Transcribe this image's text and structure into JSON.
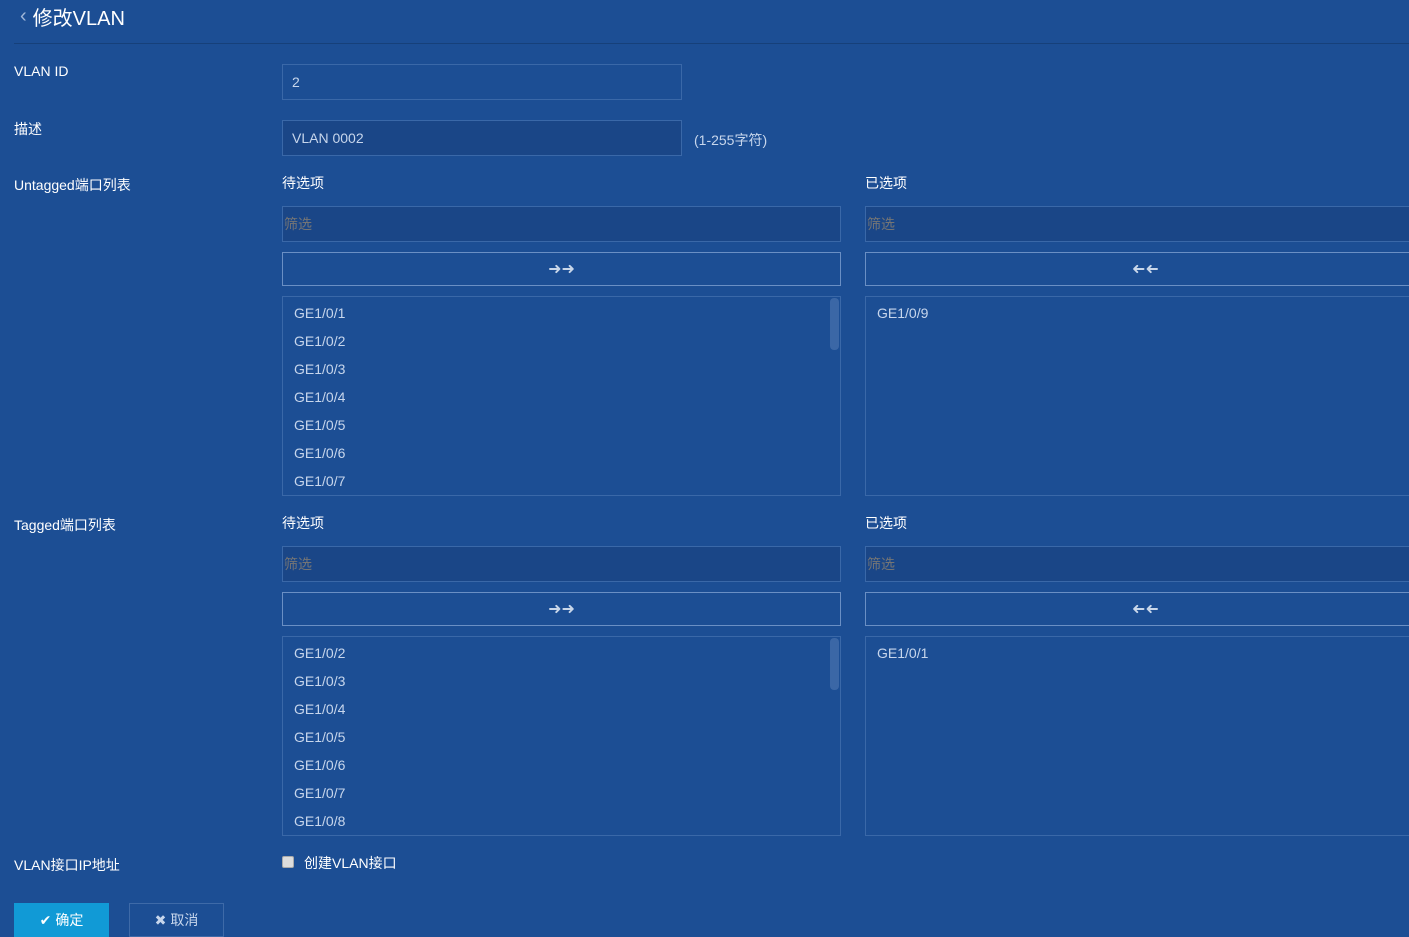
{
  "header": {
    "back_icon": "chevron-left-icon",
    "title": "修改VLAN"
  },
  "form": {
    "vlan_id": {
      "label": "VLAN ID",
      "value": "2"
    },
    "description": {
      "label": "描述",
      "value": "VLAN 0002",
      "hint": "(1-255字符)"
    },
    "untagged": {
      "label": "Untagged端口列表",
      "available_title": "待选项",
      "selected_title": "已选项",
      "filter_placeholder": "筛选",
      "available": [
        "GE1/0/1",
        "GE1/0/2",
        "GE1/0/3",
        "GE1/0/4",
        "GE1/0/5",
        "GE1/0/6",
        "GE1/0/7"
      ],
      "selected": [
        "GE1/0/9"
      ]
    },
    "tagged": {
      "label": "Tagged端口列表",
      "available_title": "待选项",
      "selected_title": "已选项",
      "filter_placeholder": "筛选",
      "available": [
        "GE1/0/2",
        "GE1/0/3",
        "GE1/0/4",
        "GE1/0/5",
        "GE1/0/6",
        "GE1/0/7",
        "GE1/0/8"
      ],
      "selected": [
        "GE1/0/1"
      ]
    },
    "vlan_if": {
      "label": "VLAN接口IP地址",
      "checkbox_label": "创建VLAN接口",
      "checked": false
    }
  },
  "actions": {
    "ok": "确定",
    "cancel": "取消"
  },
  "colors": {
    "background": "#1c4e94",
    "primary": "#119ad6"
  }
}
